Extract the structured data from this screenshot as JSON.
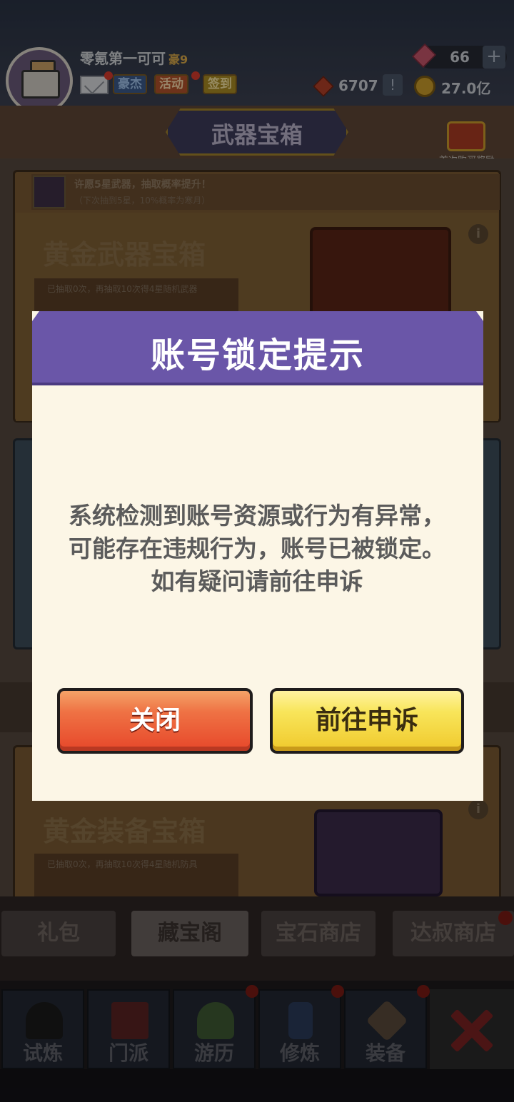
{
  "player": {
    "name": "零氪第一可可",
    "vip": "豪9",
    "gems": "66",
    "gem_plus": "+",
    "tokens": "6707",
    "token_info": "!",
    "coins": "27.0亿"
  },
  "top_buttons": {
    "haojie": "豪杰",
    "huodong": "活动",
    "qiandao": "签到"
  },
  "title": {
    "text": "武器宝箱",
    "bonus_label": "首次购买奖励"
  },
  "weapon_box": {
    "wish_text": "许愿5星武器，抽取概率提升！",
    "wish_sub": "（下次抽到5星，10%概率为寒月）",
    "name": "黄金武器宝箱",
    "draw_info": "已抽取0次，再抽取10次得4星随机武器",
    "info": "i"
  },
  "equip_box": {
    "name": "黄金装备宝箱",
    "draw_info": "已抽取0次，再抽取10次得4星随机防具",
    "info": "i"
  },
  "shop_tabs": [
    "礼包",
    "藏宝阁",
    "宝石商店",
    "达叔商店"
  ],
  "nav": [
    "试炼",
    "门派",
    "游历",
    "修炼",
    "装备"
  ],
  "dialog": {
    "title": "账号锁定提示",
    "message": "系统检测到账号资源或行为有异常，可能存在违规行为，账号已被锁定。如有疑问请前往申诉",
    "close_label": "关闭",
    "appeal_label": "前往申诉"
  },
  "colors": {
    "dialog_header": "#6a56a8",
    "dialog_body": "#fcf6e6",
    "close_button": "#ea5a34",
    "appeal_button": "#f6dc48"
  }
}
